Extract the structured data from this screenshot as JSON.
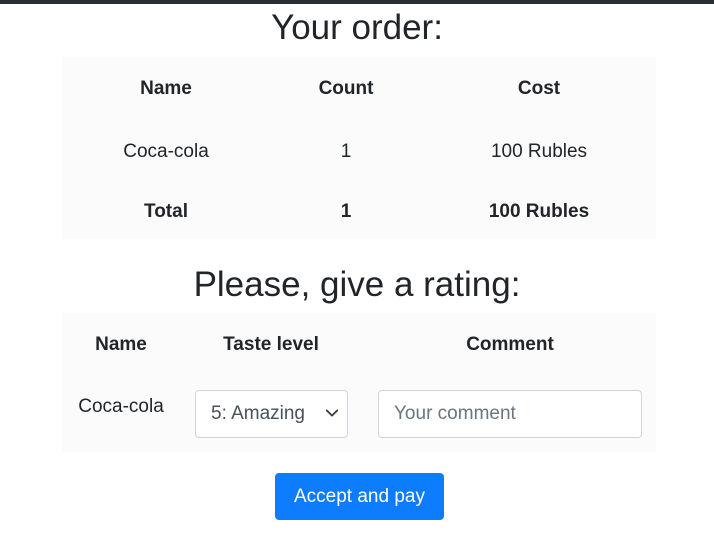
{
  "order": {
    "title": "Your order:",
    "headers": {
      "name": "Name",
      "count": "Count",
      "cost": "Cost"
    },
    "rows": [
      {
        "name": "Coca-cola",
        "count": "1",
        "cost": "100 Rubles"
      }
    ],
    "total": {
      "label": "Total",
      "count": "1",
      "cost": "100 Rubles"
    }
  },
  "rating": {
    "title": "Please, give a rating:",
    "headers": {
      "name": "Name",
      "taste": "Taste level",
      "comment": "Comment"
    },
    "rows": [
      {
        "name": "Coca-cola",
        "taste_selected": "5: Amazing",
        "comment_placeholder": "Your comment"
      }
    ]
  },
  "actions": {
    "accept_label": "Accept and pay"
  },
  "colors": {
    "accent": "#0d7cff",
    "top_bar": "#2b2d31",
    "panel_background": "#fbfbfb"
  },
  "icons": {
    "select_arrow": "chevron-down-icon"
  }
}
